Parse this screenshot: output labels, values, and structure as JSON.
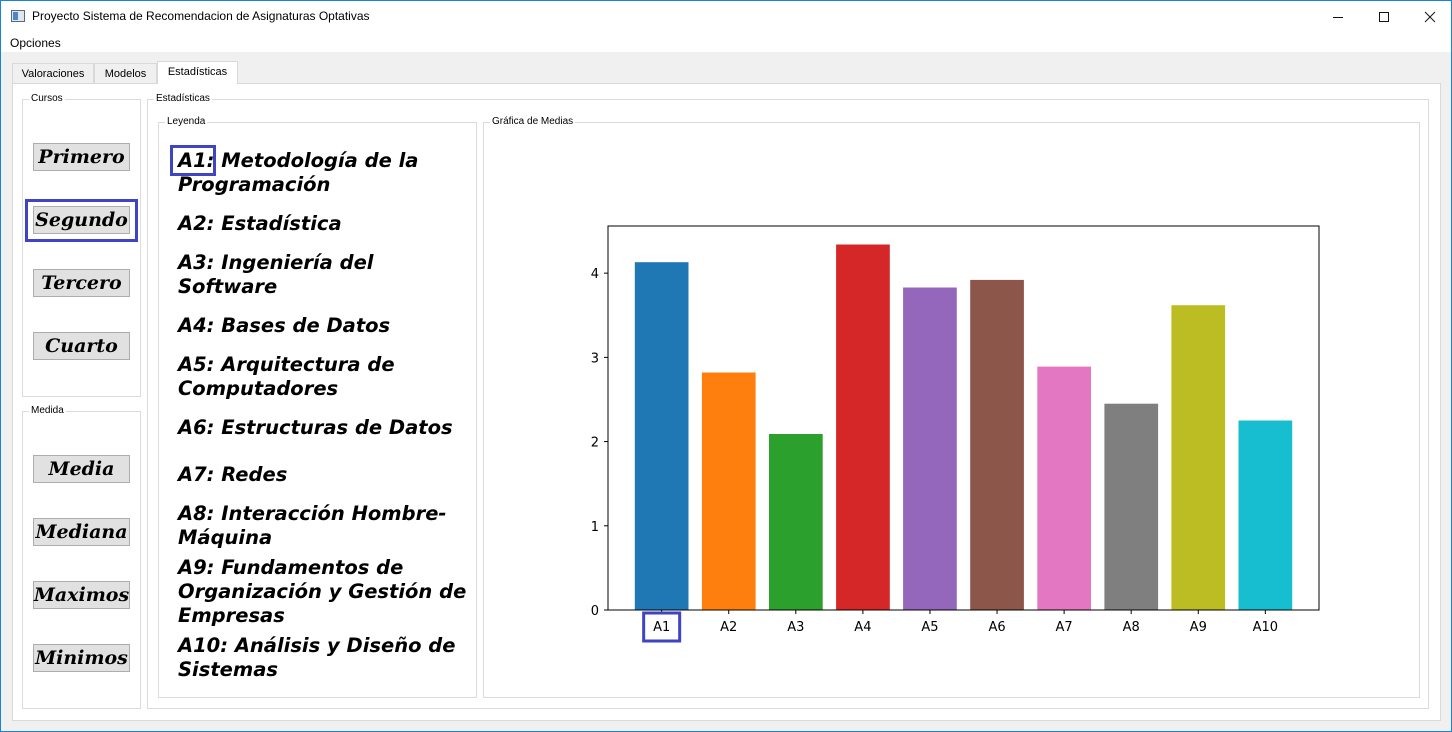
{
  "window": {
    "title": "Proyecto Sistema de Recomendacion de Asignaturas Optativas",
    "minimize_icon": "minimize-icon",
    "maximize_icon": "maximize-icon",
    "close_icon": "close-icon"
  },
  "menubar": {
    "opciones": "Opciones"
  },
  "tabs": [
    {
      "label": "Valoraciones"
    },
    {
      "label": "Modelos"
    },
    {
      "label": "Estadísticas",
      "active": true
    }
  ],
  "cursos": {
    "title": "Cursos",
    "buttons": [
      {
        "label": "Primero"
      },
      {
        "label": "Segundo",
        "highlighted": true
      },
      {
        "label": "Tercero"
      },
      {
        "label": "Cuarto"
      }
    ]
  },
  "medida": {
    "title": "Medida",
    "buttons": [
      {
        "label": "Media"
      },
      {
        "label": "Mediana"
      },
      {
        "label": "Maximos"
      },
      {
        "label": "Minimos"
      }
    ]
  },
  "estadisticas": {
    "title": "Estadísticas",
    "leyenda_title": "Leyenda",
    "grafica_title": "Gráfica de Medias",
    "legend": [
      {
        "code": "A1:",
        "text": " Metodología de la\nProgramación"
      },
      {
        "code": "A2:",
        "text": " Estadística"
      },
      {
        "code": "A3:",
        "text": " Ingeniería del\nSoftware"
      },
      {
        "code": "A4:",
        "text": " Bases de Datos"
      },
      {
        "code": "A5:",
        "text": " Arquitectura de\nComputadores"
      },
      {
        "code": "A6:",
        "text": " Estructuras de Datos"
      },
      {
        "code": "A7:",
        "text": " Redes"
      },
      {
        "code": "A8:",
        "text": " Interacción Hombre-\nMáquina"
      },
      {
        "code": "A9:",
        "text": " Fundamentos de\nOrganización y Gestión de\nEmpresas"
      },
      {
        "code": "A10:",
        "text": " Análisis y Diseño de\nSistemas"
      }
    ]
  },
  "chart_data": {
    "type": "bar",
    "categories": [
      "A1",
      "A2",
      "A3",
      "A4",
      "A5",
      "A6",
      "A7",
      "A8",
      "A9",
      "A10"
    ],
    "values": [
      4.13,
      2.82,
      2.09,
      4.34,
      3.83,
      3.92,
      2.89,
      2.45,
      3.62,
      2.25
    ],
    "colors": [
      "#1f77b4",
      "#ff7f0e",
      "#2ca02c",
      "#d62728",
      "#9467bd",
      "#8c564b",
      "#e377c2",
      "#7f7f7f",
      "#bcbd22",
      "#17becf"
    ],
    "yticks": [
      0,
      1,
      2,
      3,
      4
    ],
    "ylim": [
      0,
      4.56
    ],
    "highlighted_category": "A1",
    "highlight_color": "#3f44c4"
  }
}
